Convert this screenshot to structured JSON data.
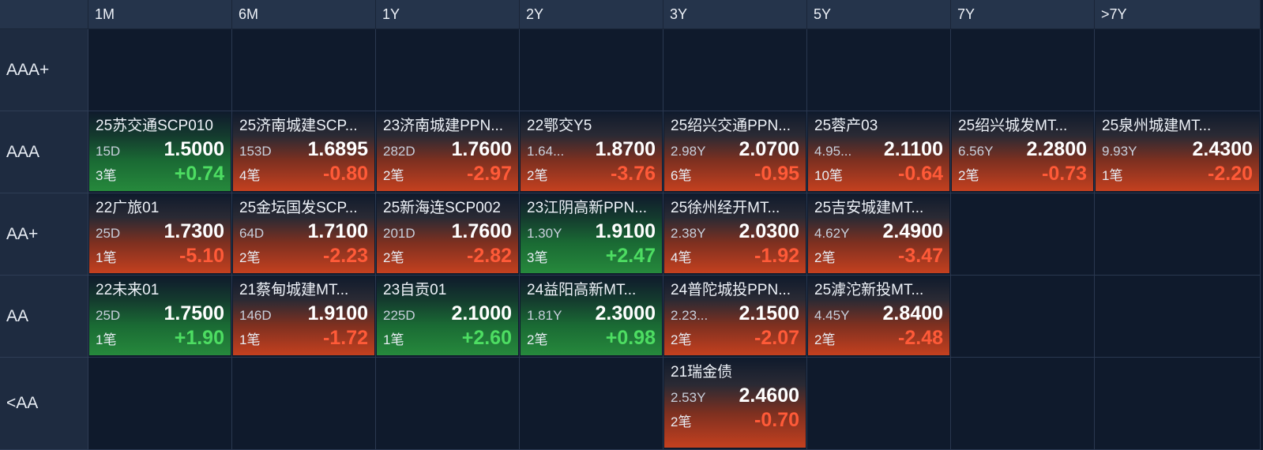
{
  "columns": [
    "1M",
    "6M",
    "1Y",
    "2Y",
    "3Y",
    "5Y",
    "7Y",
    ">7Y"
  ],
  "rows": [
    {
      "label": "AAA+",
      "cells": [
        null,
        null,
        null,
        null,
        null,
        null,
        null,
        null
      ]
    },
    {
      "label": "AAA",
      "cells": [
        {
          "name": "25苏交通SCP010",
          "term": "15D",
          "yield": "1.5000",
          "trades": "3笔",
          "change": "+0.74",
          "dir": "up"
        },
        {
          "name": "25济南城建SCP...",
          "term": "153D",
          "yield": "1.6895",
          "trades": "4笔",
          "change": "-0.80",
          "dir": "down"
        },
        {
          "name": "23济南城建PPN...",
          "term": "282D",
          "yield": "1.7600",
          "trades": "2笔",
          "change": "-2.97",
          "dir": "down"
        },
        {
          "name": "22鄂交Y5",
          "term": "1.64...",
          "yield": "1.8700",
          "trades": "2笔",
          "change": "-3.76",
          "dir": "down"
        },
        {
          "name": "25绍兴交通PPN...",
          "term": "2.98Y",
          "yield": "2.0700",
          "trades": "6笔",
          "change": "-0.95",
          "dir": "down"
        },
        {
          "name": "25蓉产03",
          "term": "4.95...",
          "yield": "2.1100",
          "trades": "10笔",
          "change": "-0.64",
          "dir": "down"
        },
        {
          "name": "25绍兴城发MT...",
          "term": "6.56Y",
          "yield": "2.2800",
          "trades": "2笔",
          "change": "-0.73",
          "dir": "down"
        },
        {
          "name": "25泉州城建MT...",
          "term": "9.93Y",
          "yield": "2.4300",
          "trades": "1笔",
          "change": "-2.20",
          "dir": "down"
        }
      ]
    },
    {
      "label": "AA+",
      "cells": [
        {
          "name": "22广旅01",
          "term": "25D",
          "yield": "1.7300",
          "trades": "1笔",
          "change": "-5.10",
          "dir": "down"
        },
        {
          "name": "25金坛国发SCP...",
          "term": "64D",
          "yield": "1.7100",
          "trades": "2笔",
          "change": "-2.23",
          "dir": "down"
        },
        {
          "name": "25新海连SCP002",
          "term": "201D",
          "yield": "1.7600",
          "trades": "2笔",
          "change": "-2.82",
          "dir": "down"
        },
        {
          "name": "23江阴高新PPN...",
          "term": "1.30Y",
          "yield": "1.9100",
          "trades": "3笔",
          "change": "+2.47",
          "dir": "up"
        },
        {
          "name": "25徐州经开MT...",
          "term": "2.38Y",
          "yield": "2.0300",
          "trades": "4笔",
          "change": "-1.92",
          "dir": "down"
        },
        {
          "name": "25吉安城建MT...",
          "term": "4.62Y",
          "yield": "2.4900",
          "trades": "2笔",
          "change": "-3.47",
          "dir": "down"
        },
        null,
        null
      ]
    },
    {
      "label": "AA",
      "cells": [
        {
          "name": "22未来01",
          "term": "25D",
          "yield": "1.7500",
          "trades": "1笔",
          "change": "+1.90",
          "dir": "up"
        },
        {
          "name": "21蔡甸城建MT...",
          "term": "146D",
          "yield": "1.9100",
          "trades": "1笔",
          "change": "-1.72",
          "dir": "down"
        },
        {
          "name": "23自贡01",
          "term": "225D",
          "yield": "2.1000",
          "trades": "1笔",
          "change": "+2.60",
          "dir": "up"
        },
        {
          "name": "24益阳高新MT...",
          "term": "1.81Y",
          "yield": "2.3000",
          "trades": "2笔",
          "change": "+0.98",
          "dir": "up"
        },
        {
          "name": "24普陀城投PPN...",
          "term": "2.23...",
          "yield": "2.1500",
          "trades": "2笔",
          "change": "-2.07",
          "dir": "down"
        },
        {
          "name": "25滹沱新投MT...",
          "term": "4.45Y",
          "yield": "2.8400",
          "trades": "2笔",
          "change": "-2.48",
          "dir": "down"
        },
        null,
        null
      ]
    },
    {
      "label": "<AA",
      "cells": [
        null,
        null,
        null,
        null,
        {
          "name": "21瑞金债",
          "term": "2.53Y",
          "yield": "2.4600",
          "trades": "2笔",
          "change": "-0.70",
          "dir": "down"
        },
        null,
        null,
        null
      ]
    }
  ],
  "colors": {
    "up": "#4ddd62",
    "down": "#ff5a38",
    "header_bg": "#25344b",
    "page_bg": "#0f1a2c"
  }
}
